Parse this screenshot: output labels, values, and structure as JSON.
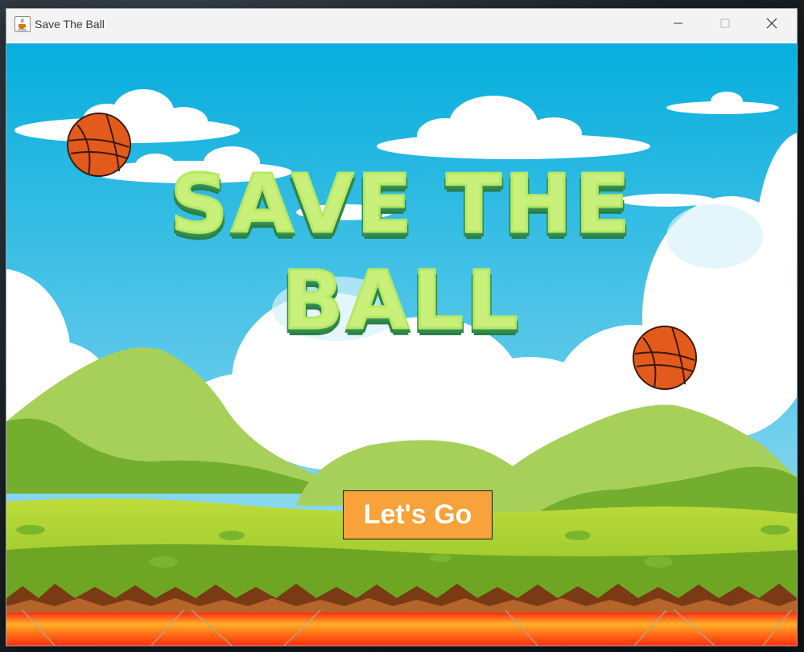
{
  "window": {
    "title": "Save The Ball",
    "icon": "java-cup-icon",
    "controls": [
      "minimize-icon",
      "maximize-icon",
      "close-icon"
    ]
  },
  "game": {
    "title_line_1": "SAVE THE",
    "title_line_2": "BALL",
    "start_button_label": "Let's Go",
    "ball_icon": "basketball-icon",
    "colors": {
      "sky_top": "#14b0de",
      "sky_bottom": "#a8e2f2",
      "title_fill": "#c9f07a",
      "title_shadow": "#2f8a4d",
      "button_bg": "#f7a23a",
      "ball": "#e05a1e",
      "lava": "#ff4a1a"
    }
  }
}
